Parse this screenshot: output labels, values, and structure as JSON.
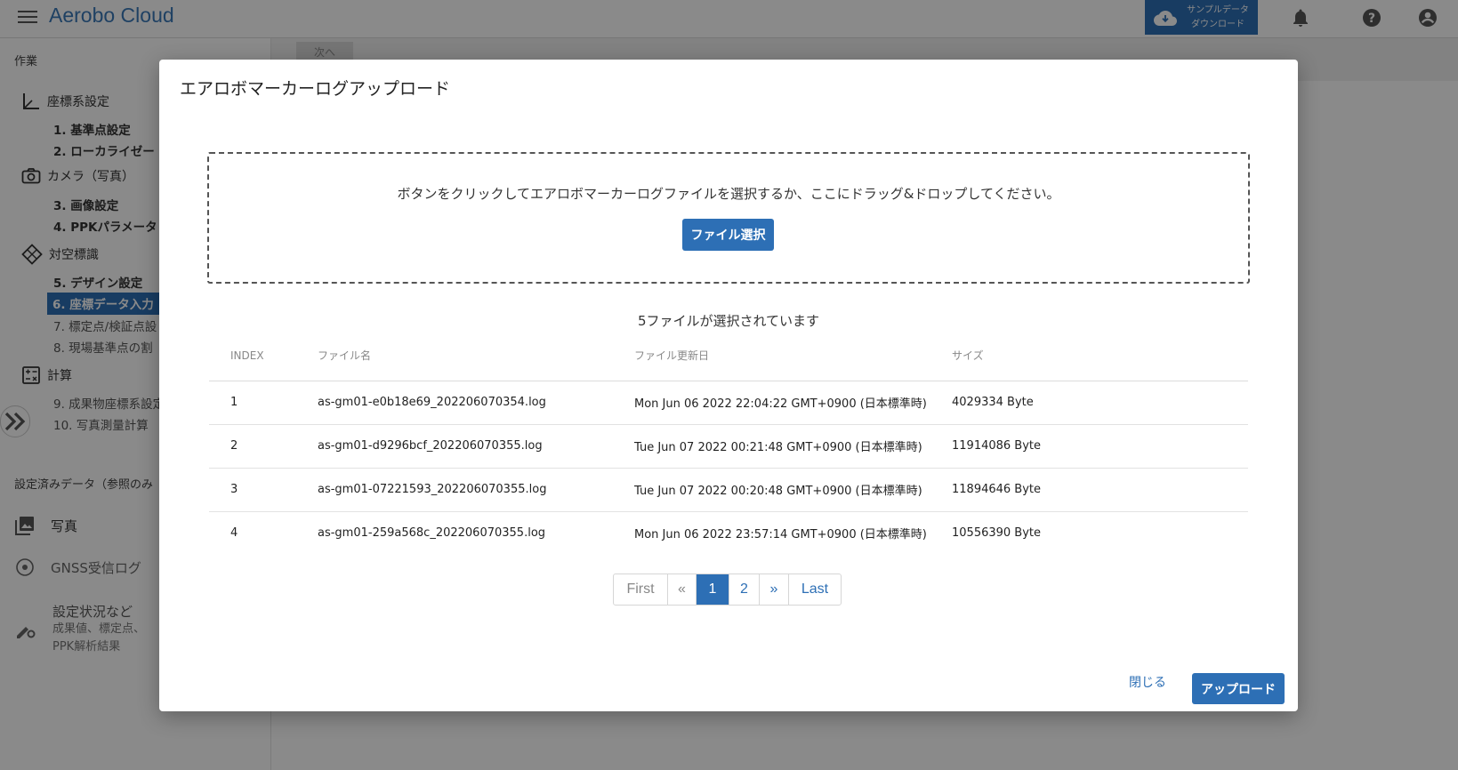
{
  "header": {
    "app_title": "Aerobo Cloud",
    "sample_download": "サンプルデータ ダウンロード",
    "icons": [
      "menu-icon",
      "cloud-download-icon",
      "bell-icon",
      "help-icon",
      "account-icon"
    ]
  },
  "sidebar": {
    "section_work": "作業",
    "groups": [
      {
        "label": "座標系設定",
        "icon": "axis-icon",
        "steps": [
          "1. 基準点設定",
          "2. ローカライゼー"
        ]
      },
      {
        "label": "カメラ（写真）",
        "icon": "camera-icon",
        "steps": [
          "3. 画像設定",
          "4. PPKパラメータ"
        ]
      },
      {
        "label": "対空標識",
        "icon": "target-icon",
        "steps": [
          "5. デザイン設定",
          "6. 座標データ入力",
          "7. 標定点/検証点設",
          "8. 現場基準点の割"
        ]
      },
      {
        "label": "計算",
        "icon": "calculator-icon",
        "steps": [
          "9. 成果物座標系設定",
          "10. 写真測量計算"
        ]
      }
    ],
    "section_configured": "設定済みデータ（参照のみ",
    "data_items": [
      {
        "label": "写真",
        "icon": "photo-library-icon"
      },
      {
        "label": "GNSS受信ログ",
        "icon": "gnss-icon"
      },
      {
        "label": "設定状況など",
        "sub1": "成果値、標定点、",
        "sub2": "PPK解析結果",
        "icon": "settings-edit-icon"
      }
    ]
  },
  "main_bg": {
    "toolbar_button": "次へ"
  },
  "modal": {
    "title": "エアロボマーカーログアップロード",
    "dropzone_text": "ボタンをクリックしてエアロボマーカーログファイルを選択するか、ここにドラッグ&ドロップしてください。",
    "file_select_label": "ファイル選択",
    "selected_count_text": "5ファイルが選択されています",
    "table": {
      "headers": [
        "INDEX",
        "ファイル名",
        "ファイル更新日",
        "サイズ"
      ],
      "rows": [
        [
          "1",
          "as-gm01-e0b18e69_202206070354.log",
          "Mon Jun 06 2022 22:04:22 GMT+0900 (日本標準時)",
          "4029334 Byte"
        ],
        [
          "2",
          "as-gm01-d9296bcf_202206070355.log",
          "Tue Jun 07 2022 00:21:48 GMT+0900 (日本標準時)",
          "11914086 Byte"
        ],
        [
          "3",
          "as-gm01-07221593_202206070355.log",
          "Tue Jun 07 2022 00:20:48 GMT+0900 (日本標準時)",
          "11894646 Byte"
        ],
        [
          "4",
          "as-gm01-259a568c_202206070355.log",
          "Mon Jun 06 2022 23:57:14 GMT+0900 (日本標準時)",
          "10556390 Byte"
        ]
      ]
    },
    "pagination": {
      "first": "First",
      "prev": "«",
      "pages": [
        "1",
        "2"
      ],
      "current_page": "1",
      "next": "»",
      "last": "Last"
    },
    "close_label": "閉じる",
    "upload_label": "アップロード"
  }
}
